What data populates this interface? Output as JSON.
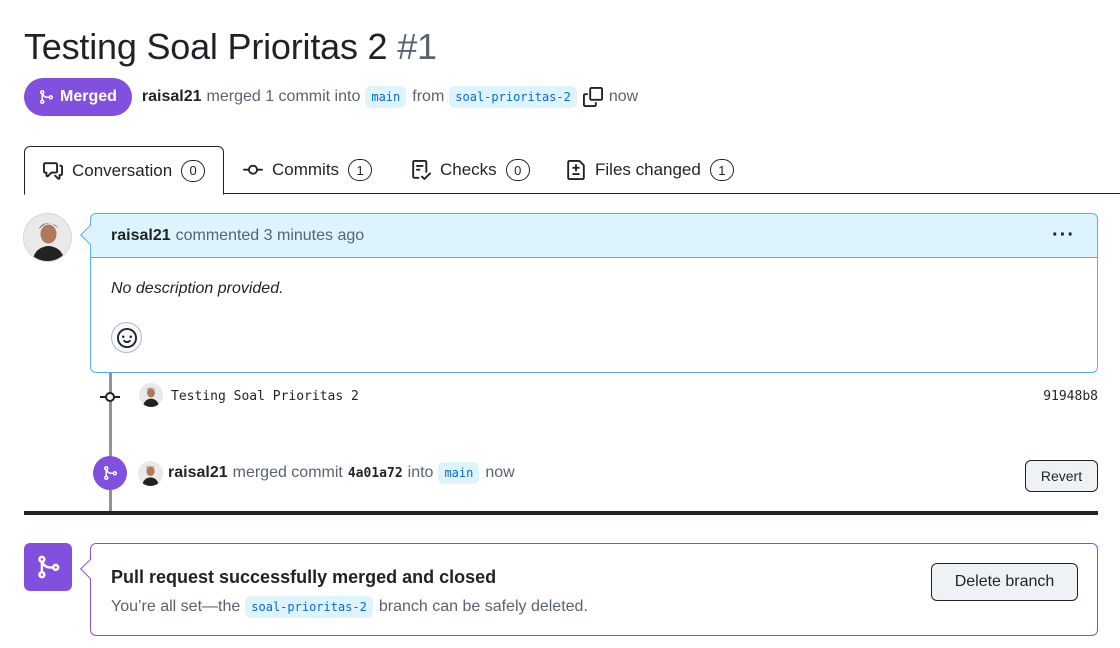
{
  "pr": {
    "title": "Testing Soal Prioritas 2",
    "number": "#1",
    "state_label": "Merged",
    "author": "raisal21",
    "merged_text": "merged 1 commit into",
    "base_branch": "main",
    "from_text": "from",
    "head_branch": "soal-prioritas-2",
    "time": "now"
  },
  "tabs": [
    {
      "label": "Conversation",
      "count": "0",
      "icon": "comment-discussion-icon",
      "active": true
    },
    {
      "label": "Commits",
      "count": "1",
      "icon": "git-commit-icon"
    },
    {
      "label": "Checks",
      "count": "0",
      "icon": "checklist-icon"
    },
    {
      "label": "Files changed",
      "count": "1",
      "icon": "file-diff-icon"
    }
  ],
  "comment": {
    "author": "raisal21",
    "meta": "commented 3 minutes ago",
    "body": "No description provided.",
    "menu_icon": "kebab-horizontal-icon",
    "reaction_icon": "smiley-icon"
  },
  "commit": {
    "message": "Testing Soal Prioritas 2",
    "sha": "91948b8"
  },
  "merge_event": {
    "author": "raisal21",
    "text": "merged commit",
    "sha": "4a01a72",
    "into_text": "into",
    "branch": "main",
    "time": "now",
    "revert_label": "Revert"
  },
  "merge_box": {
    "title": "Pull request successfully merged and closed",
    "sub_prefix": "You’re all set—the",
    "branch": "soal-prioritas-2",
    "sub_suffix": "branch can be safely deleted.",
    "delete_label": "Delete branch"
  },
  "colors": {
    "merged_purple": "#8250df",
    "comment_border": "#54aeff",
    "comment_header_bg": "#ddf4ff",
    "text": "#1f2328",
    "muted": "#59636e"
  }
}
